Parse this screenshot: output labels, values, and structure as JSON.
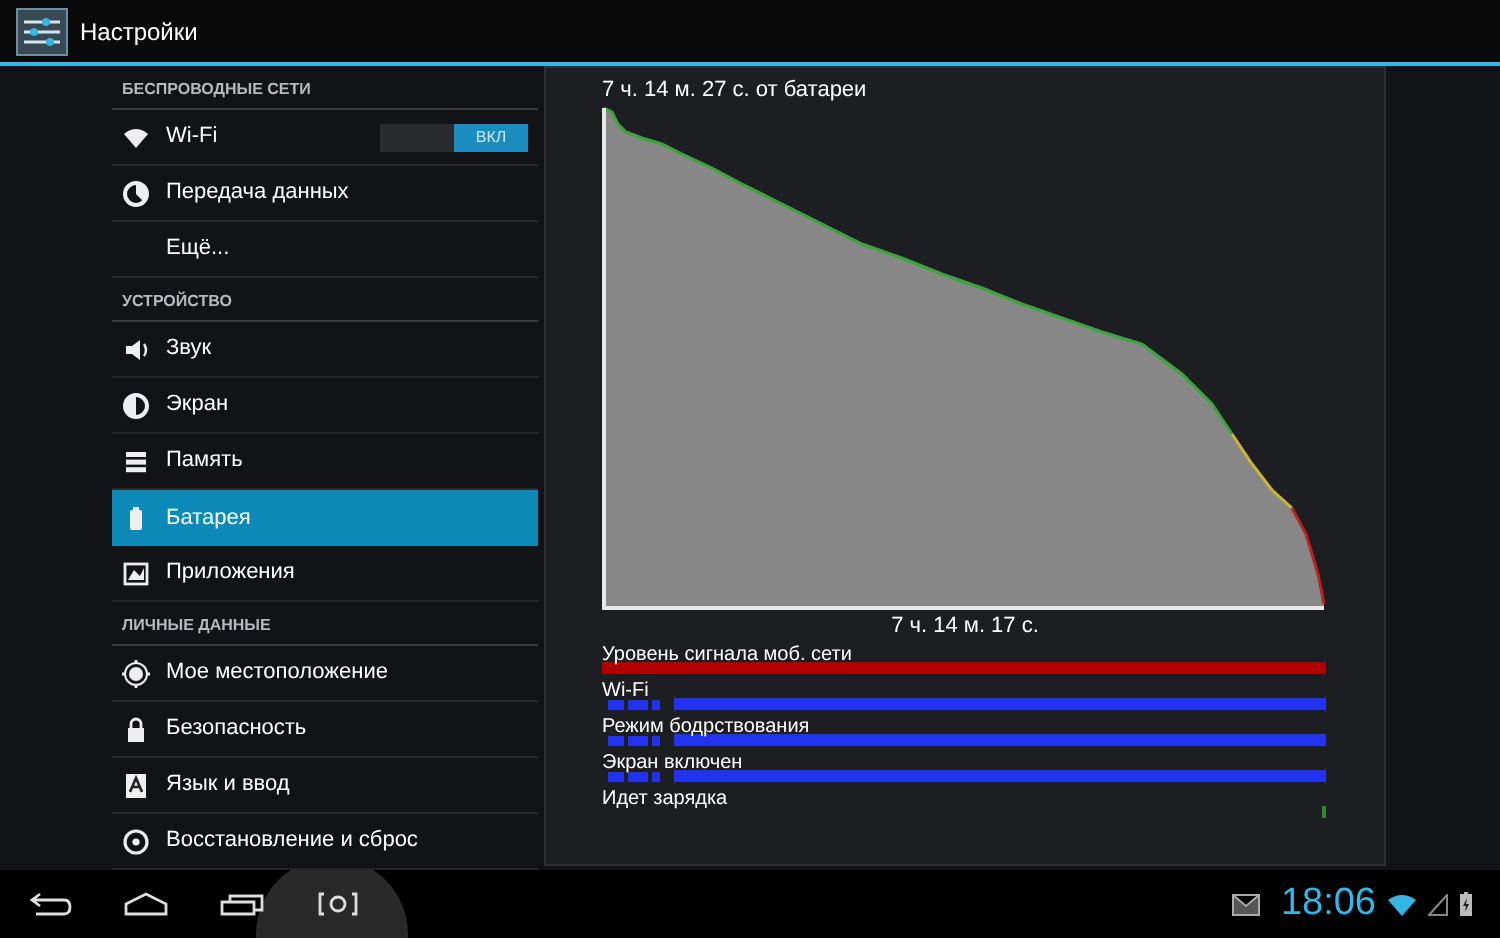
{
  "action_bar": {
    "title": "Настройки"
  },
  "sidebar": {
    "items": [
      {
        "kind": "header",
        "label": "БЕСПРОВОДНЫЕ СЕТИ"
      },
      {
        "kind": "item",
        "label": "Wi-Fi",
        "selected": false,
        "toggle": {
          "label": "ВКЛ",
          "on": true
        }
      },
      {
        "kind": "item",
        "label": "Передача данных",
        "selected": false
      },
      {
        "kind": "item",
        "label": "Ещё...",
        "selected": false
      },
      {
        "kind": "header",
        "label": "УСТРОЙСТВО"
      },
      {
        "kind": "item",
        "label": "Звук",
        "selected": false
      },
      {
        "kind": "item",
        "label": "Экран",
        "selected": false
      },
      {
        "kind": "item",
        "label": "Память",
        "selected": false
      },
      {
        "kind": "item",
        "label": "Батарея",
        "selected": true
      },
      {
        "kind": "item",
        "label": "Приложения",
        "selected": false
      },
      {
        "kind": "header",
        "label": "ЛИЧНЫЕ ДАННЫЕ"
      },
      {
        "kind": "item",
        "label": "Мое местоположение",
        "selected": false
      },
      {
        "kind": "item",
        "label": "Безопасность",
        "selected": false
      },
      {
        "kind": "item",
        "label": "Язык и ввод",
        "selected": false
      },
      {
        "kind": "item",
        "label": "Восстановление и сброс",
        "selected": false
      }
    ]
  },
  "battery": {
    "title": "7 ч. 14 м. 27 с. от батареи",
    "duration": "7 ч. 14 м. 17 с.",
    "timelines": [
      {
        "label": "Уровень сигнала моб. сети",
        "kind": "full",
        "color": "#b00000"
      },
      {
        "label": "Wi-Fi",
        "kind": "segmented",
        "color": "#2233ee"
      },
      {
        "label": "Режим бодрствования",
        "kind": "segmented",
        "color": "#2233ee"
      },
      {
        "label": "Экран включен",
        "kind": "segmented",
        "color": "#2233ee"
      },
      {
        "label": "Идет зарядка",
        "kind": "tick",
        "color": "#2a8a2a"
      }
    ]
  },
  "status_bar": {
    "time": "18:06"
  }
}
